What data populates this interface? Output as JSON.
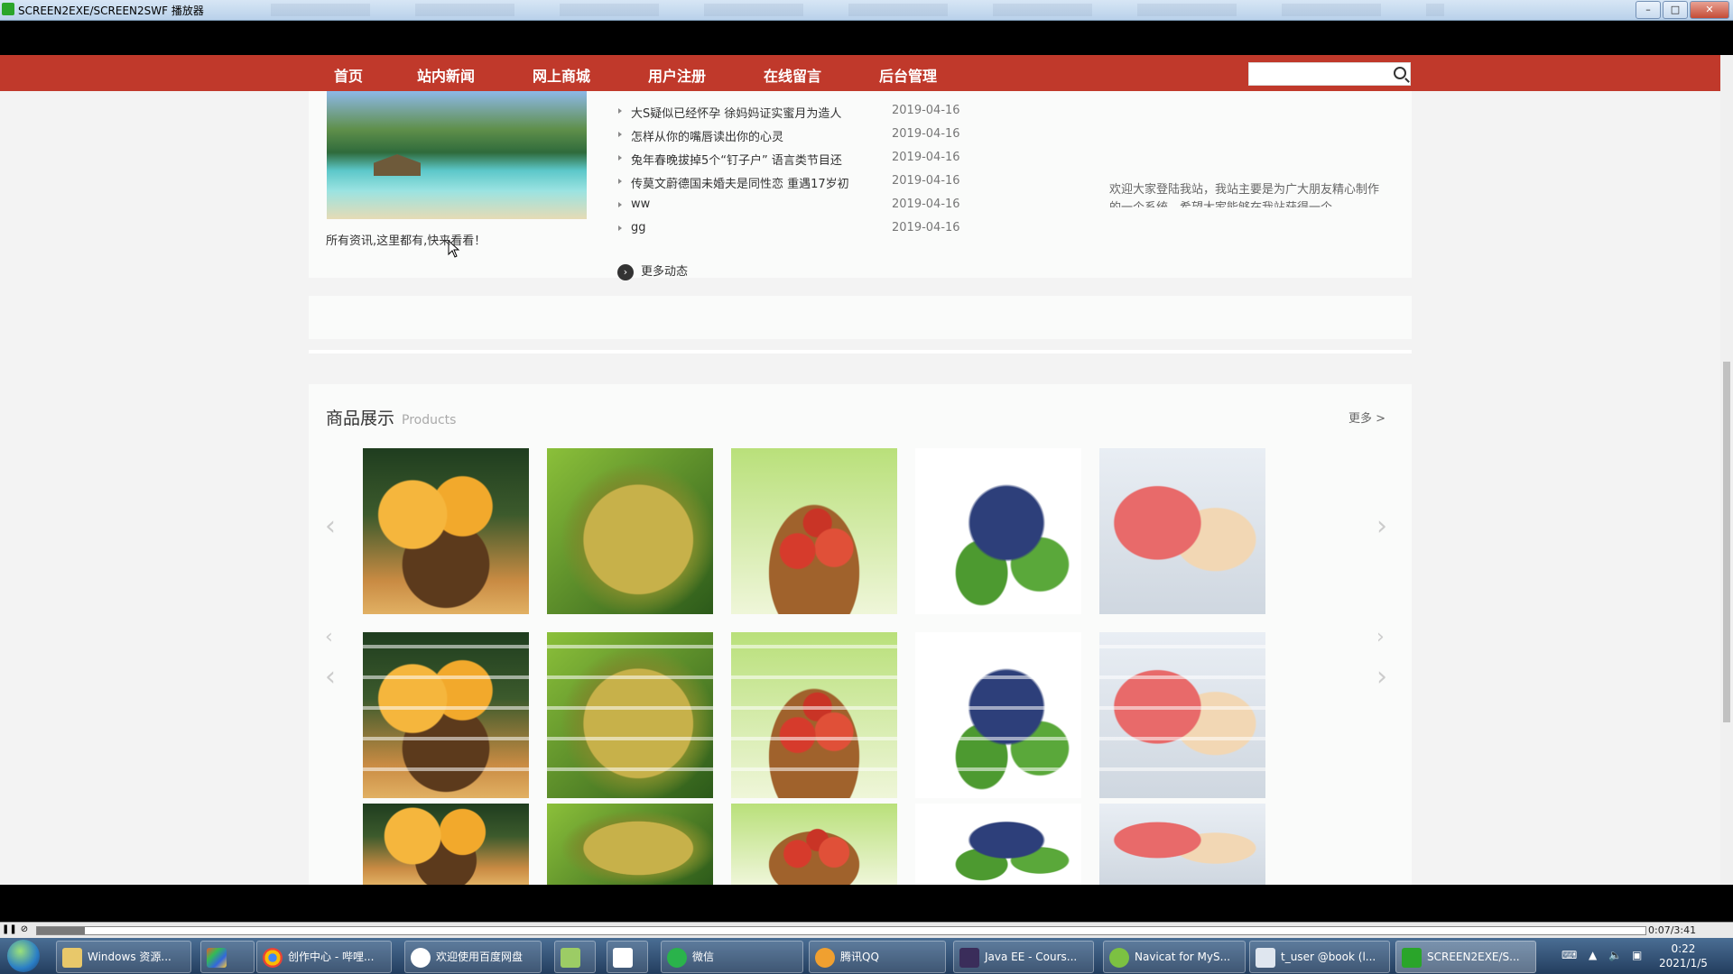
{
  "window": {
    "title": "SCREEN2EXE/SCREEN2SWF 播放器"
  },
  "nav": {
    "items": [
      "首页",
      "站内新闻",
      "网上商城",
      "用户注册",
      "在线留言",
      "后台管理"
    ],
    "search_placeholder": ""
  },
  "news": {
    "caption": "所有资讯,这里都有,快来看看！",
    "items": [
      {
        "title": "大S疑似已经怀孕 徐妈妈证实蜜月为造人",
        "date": "2019-04-16"
      },
      {
        "title": "怎样从你的嘴唇读出你的心灵",
        "date": "2019-04-16"
      },
      {
        "title": "兔年春晚拔掉5个“钉子户” 语言类节目还",
        "date": "2019-04-16"
      },
      {
        "title": "传莫文蔚德国未婚夫是同性恋 重遇17岁初",
        "date": "2019-04-16"
      },
      {
        "title": "ww",
        "date": "2019-04-16"
      },
      {
        "title": "gg",
        "date": "2019-04-16"
      }
    ],
    "more_label": "更多动态",
    "welcome_text": "欢迎大家登陆我站，我站主要是为广大朋友精心制作的一个系统，希望大家能够在我站获得一个"
  },
  "products": {
    "title": "商品展示",
    "title_en": "Products",
    "more_label": "更多 >",
    "items": [
      "mango",
      "durian",
      "apple",
      "grape",
      "peach"
    ]
  },
  "player": {
    "time": "0:07/3:41",
    "progress": 0.03
  },
  "taskbar": {
    "tasks": [
      "Windows 资源...",
      "",
      "创作中心 - 哔哩...",
      "欢迎使用百度网盘",
      "",
      "",
      "微信",
      "腾讯QQ",
      "Java EE - Cours...",
      "Navicat for MyS...",
      "t_user @book (l...",
      "SCREEN2EXE/S..."
    ],
    "clock_time": "0:22",
    "clock_date": "2021/1/5"
  },
  "colors": {
    "nav_bg": "#c0392b",
    "page_bg": "#f3f3f3",
    "panel_bg": "#fafbfa"
  }
}
